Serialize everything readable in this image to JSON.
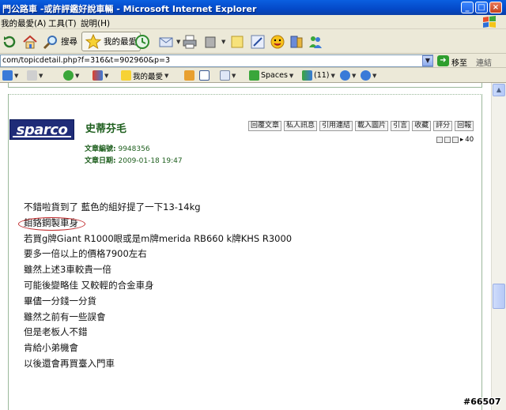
{
  "window": {
    "title": "門公路車 -或許評鑑好說車輛 - Microsoft Internet Explorer",
    "minimize_glyph": "_",
    "maximize_glyph": "□",
    "close_glyph": "×"
  },
  "menu": {
    "items": [
      "我的最愛(A)",
      "工具(T)",
      "說明(H)"
    ]
  },
  "toolbar": {
    "search_label": "搜尋",
    "favorites_label": "我的最愛"
  },
  "address": {
    "url": "com/topicdetail.php?f=316&t=902960&p=3",
    "go_label": "移至",
    "links_label": "連結"
  },
  "linksbar": {
    "favorites_label": "我的最愛",
    "spaces_label": "Spaces",
    "mail_count_label": "(11)"
  },
  "post": {
    "logo_text": "sparco",
    "username": "史蒂芬毛",
    "actions": [
      "回覆文章",
      "私人訊息",
      "引用連結",
      "載入圖片",
      "引言",
      "收藏",
      "評分",
      "回報"
    ],
    "nav_label": "40",
    "article_id_label": "文章編號:",
    "article_id": "9948356",
    "article_date_label": "文章日期:",
    "article_date": "2009-01-18 19:47",
    "lines": [
      "不錯啦貨到了 藍色的組好提了一下13-14kg",
      "鉬鉻鋼製車身",
      "若買g牌Giant R1000眼或是m牌merida RB660 k牌KHS R3000",
      "要多一倍以上的價格7900左右",
      "雖然上述3車較貴一倍",
      "可能後變略佳 又較輕的合金車身",
      "畢儘一分錢一分貨",
      "雖然之前有一些誤會",
      "但是老板人不錯",
      "肯給小弟機會",
      "以後還會再買臺入門車"
    ]
  },
  "watermark": "#66507"
}
